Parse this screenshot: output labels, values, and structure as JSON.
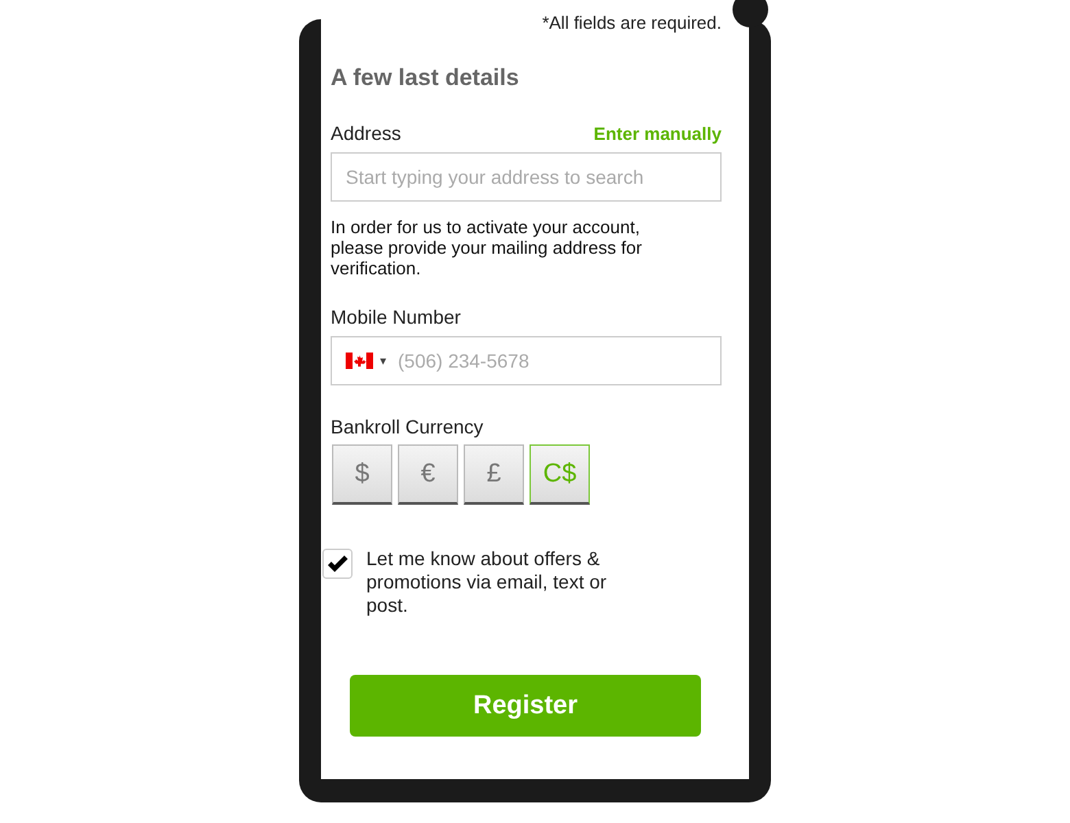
{
  "required_note": "*All fields are required.",
  "heading": "A few last details",
  "address": {
    "label": "Address",
    "link": "Enter manually",
    "placeholder": "Start typing your address to search",
    "help": "In order for us to activate your account, please provide your mailing address for verification."
  },
  "mobile": {
    "label": "Mobile Number",
    "country_caret": "▾",
    "placeholder": "(506) 234-5678"
  },
  "currency": {
    "label": "Bankroll Currency",
    "options": [
      {
        "symbol": "$",
        "selected": false
      },
      {
        "symbol": "€",
        "selected": false
      },
      {
        "symbol": "£",
        "selected": false
      },
      {
        "symbol": "C$",
        "selected": true
      }
    ]
  },
  "offers": {
    "checked": true,
    "label": "Let me know about offers & promotions via email, text or post."
  },
  "register_button": "Register"
}
